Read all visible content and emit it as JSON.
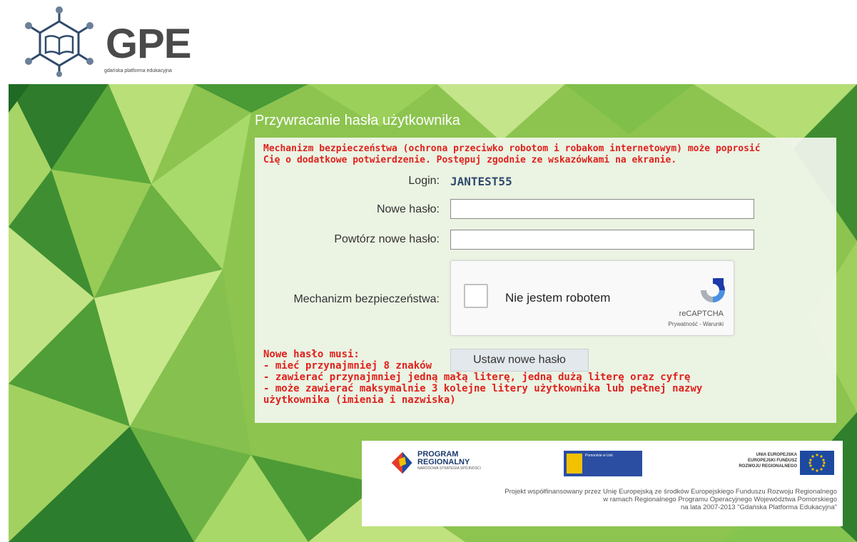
{
  "brand": {
    "logo_text": "GPE",
    "logo_sub": "gdańska platforma edukacyjna"
  },
  "page": {
    "title": "Przywracanie hasła użytkownika"
  },
  "form": {
    "warning_line1": "Mechanizm bezpieczeństwa (ochrona przeciwko robotom i robakom internetowym) może poprosić",
    "warning_line2": "Cię o dodatkowe potwierdzenie. Postępuj zgodnie ze wskazówkami na ekranie.",
    "login_label": "Login:",
    "login_value": "JANTEST55",
    "new_password_label": "Nowe hasło:",
    "new_password_value": "",
    "repeat_password_label": "Powtórz nowe hasło:",
    "repeat_password_value": "",
    "security_label": "Mechanizm bezpieczeństwa:",
    "submit_label": "Ustaw nowe hasło"
  },
  "captcha": {
    "checkbox_label": "Nie jestem robotem",
    "brand": "reCAPTCHA",
    "links": "Prywatność - Warunki",
    "checked": false
  },
  "rules": {
    "heading": "Nowe hasło musi:",
    "items": [
      "- mieć przynajmniej 8 znaków",
      "- zawierać przynajmniej jedną małą literę, jedną dużą literę oraz cyfrę",
      "- może zawierać maksymalnie 3 kolejne litery użytkownika lub pełnej nazwy",
      "użytkownika (imienia i nazwiska)"
    ]
  },
  "sponsors": {
    "program_title_1": "PROGRAM",
    "program_title_2": "REGIONALNY",
    "program_sub": "NARODOWA STRATEGIA SPÓJNOŚCI",
    "pomorskie_text": "Pomorskie w Unii",
    "ue_line1": "UNIA EUROPEJSKA",
    "ue_line2": "EUROPEJSKI FUNDUSZ",
    "ue_line3": "ROZWOJU REGIONALNEGO",
    "note_line1": "Projekt współfinansowany przez Unię Europejską ze środków Europejskiego Funduszu Rozwoju Regionalnego",
    "note_line2": "w ramach Regionalnego Programu Operacyjnego Województwa Pomorskiego",
    "note_line3": "na lata 2007-2013 \"Gdańska Platforma Edukacyjna\""
  },
  "colors": {
    "warning_red": "#e0211c",
    "login_value": "#2f4a6b",
    "bg_green_light": "#a9d66a",
    "bg_green_dark": "#2d7d2e"
  }
}
